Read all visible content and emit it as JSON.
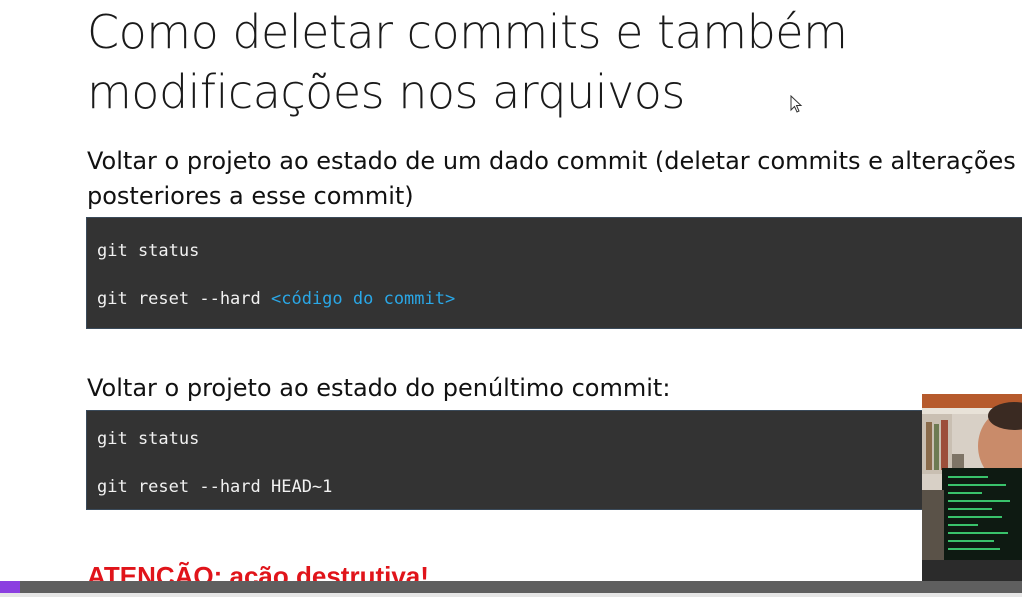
{
  "slide": {
    "title_lines": [
      "Como deletar commits e também",
      "modificações nos arquivos"
    ],
    "section1": {
      "text_lines": [
        "Voltar o projeto ao estado de um dado commit (deletar commits e alterações",
        "posteriores a esse commit)"
      ],
      "code": {
        "line1": "git status",
        "line2_cmd": "git reset --hard ",
        "line2_placeholder": "<código do commit>"
      }
    },
    "section2": {
      "text": "Voltar o projeto ao estado do penúltimo commit:",
      "code": {
        "line1": "git status",
        "line2": "git reset --hard HEAD~1"
      }
    },
    "warning": "ATENÇÃO: ação destrutiva!"
  },
  "player": {
    "progress": 0.02,
    "colors": {
      "played": "#8b3fe0",
      "track": "#5f5f5f"
    }
  },
  "colors": {
    "code_bg": "#333333",
    "placeholder": "#2aa7e6",
    "warning": "#e0141a"
  },
  "icons": {
    "cursor": "mouse-pointer-icon"
  }
}
